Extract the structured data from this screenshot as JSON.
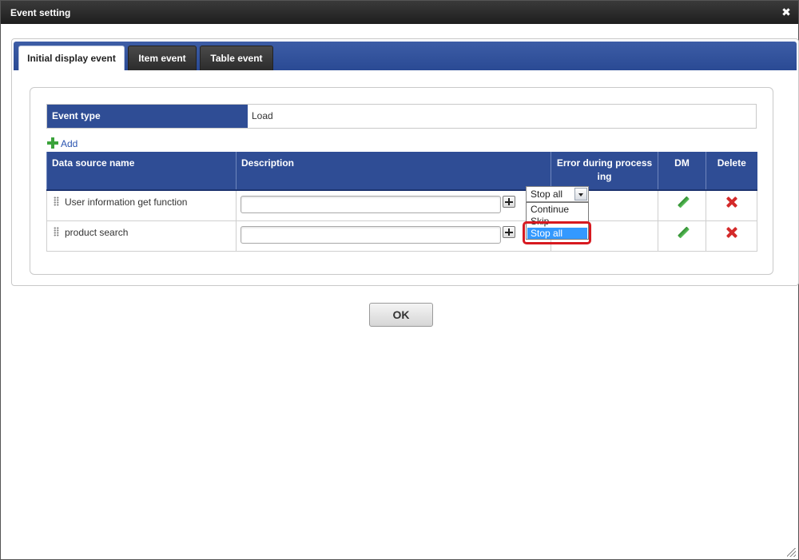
{
  "window": {
    "title": "Event setting",
    "close_icon": "close-icon"
  },
  "tabs": [
    {
      "label": "Initial display event",
      "active": true
    },
    {
      "label": "Item event",
      "active": false
    },
    {
      "label": "Table event",
      "active": false
    }
  ],
  "event_type": {
    "label": "Event type",
    "value": "Load"
  },
  "add_link": {
    "label": "Add",
    "icon": "plus-icon"
  },
  "table": {
    "headers": [
      "Data source name",
      "Description",
      "Error during processing",
      "DM",
      "Delete"
    ],
    "rows": [
      {
        "name": "User information get function",
        "description": "",
        "error_action": ""
      },
      {
        "name": "product search",
        "description": "",
        "error_action": "Stop all"
      }
    ]
  },
  "dropdown": {
    "options": [
      "Continue",
      "Skip",
      "Stop all"
    ],
    "selected": "Stop all"
  },
  "colors": {
    "header_blue": "#2f4d95",
    "tabbar_blue": "#2a4a94",
    "highlight_red": "#d71920",
    "selection_blue": "#3399ff"
  },
  "footer": {
    "ok_label": "OK"
  }
}
